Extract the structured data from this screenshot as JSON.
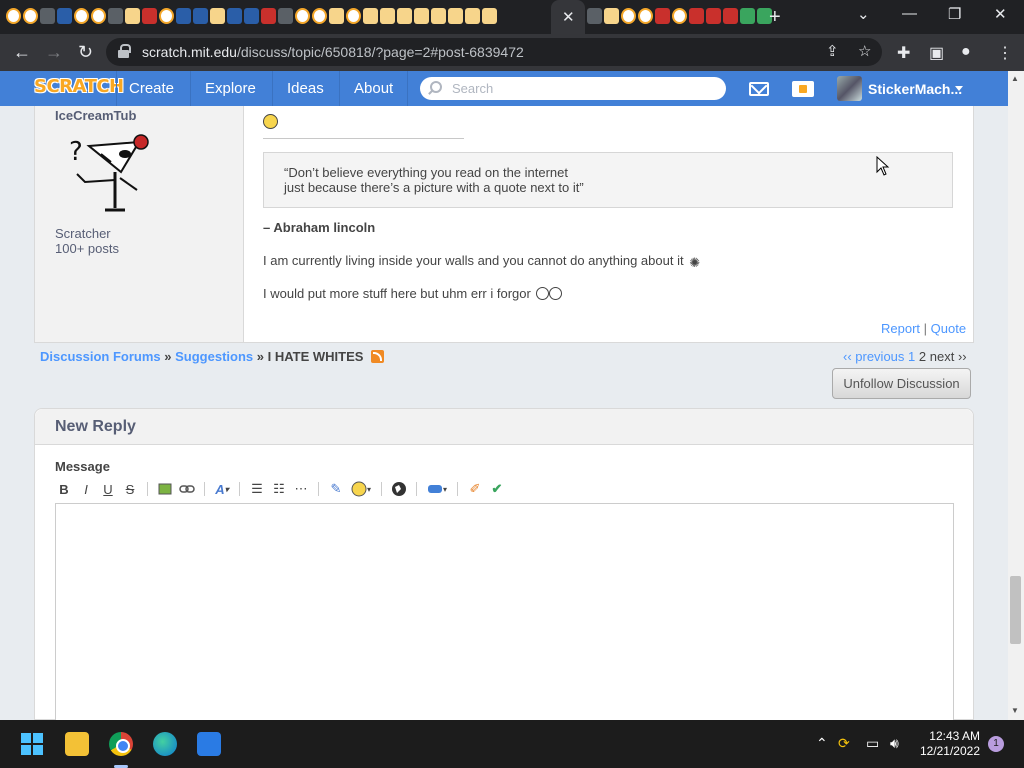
{
  "browser": {
    "active_tab_close": "✕",
    "new_tab": "+",
    "url_host": "scratch.mit.edu",
    "url_path": "/discuss/topic/650818/?page=2#post-6839472",
    "window_controls": {
      "minimize": "—",
      "restore": "❐",
      "close": "✕",
      "tab_search": "⌄"
    }
  },
  "nav": {
    "logo": "SCRATCH",
    "links": [
      "Create",
      "Explore",
      "Ideas",
      "About"
    ],
    "search_placeholder": "Search",
    "username": "StickerMach..."
  },
  "post": {
    "author": "IceCreamTub",
    "rank": "Scratcher",
    "post_count": "100+ posts",
    "quote_lines": [
      "“Don’t believe everything you read on the internet",
      "just because there’s a picture with a quote next to it”"
    ],
    "quote_attribution": "– Abraham lincoln",
    "signature_line_1": "I am currently living inside your walls and you cannot do anything about it",
    "signature_line_2": "I would put more stuff here but uhm err i forgor",
    "report": "Report",
    "separator": "|",
    "quote_action": "Quote"
  },
  "breadcrumb": {
    "forums": "Discussion Forums",
    "sep": "»",
    "category": "Suggestions",
    "topic": "I HATE WHITES"
  },
  "pager": {
    "previous": "‹‹ previous",
    "page1": "1",
    "current": "2",
    "next": "next ››"
  },
  "unfollow_label": "Unfollow Discussion",
  "reply": {
    "title": "New Reply",
    "message_label": "Message",
    "toolbar": [
      "B",
      "I",
      "U",
      "S"
    ]
  },
  "taskbar": {
    "time": "12:43 AM",
    "date": "12/21/2022",
    "notification_count": "1"
  },
  "colors": {
    "scratch_blue": "#4280d7",
    "link": "#4d97ff",
    "logo_orange": "#f9a823"
  }
}
